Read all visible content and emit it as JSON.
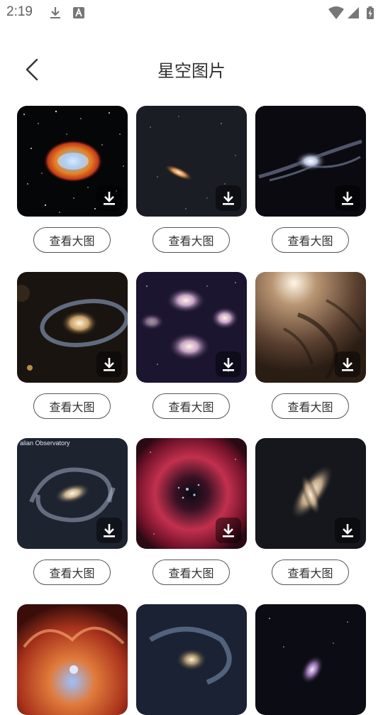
{
  "status_bar": {
    "time": "2:19",
    "icons": [
      "download-icon",
      "font-a-icon",
      "wifi-icon",
      "signal-icon",
      "battery-icon"
    ]
  },
  "header": {
    "title": "星空图片",
    "back_icon": "chevron-left-icon"
  },
  "gallery": {
    "view_label": "查看大图",
    "download_icon": "download-icon",
    "credit_text": "alian Observatory"
  }
}
